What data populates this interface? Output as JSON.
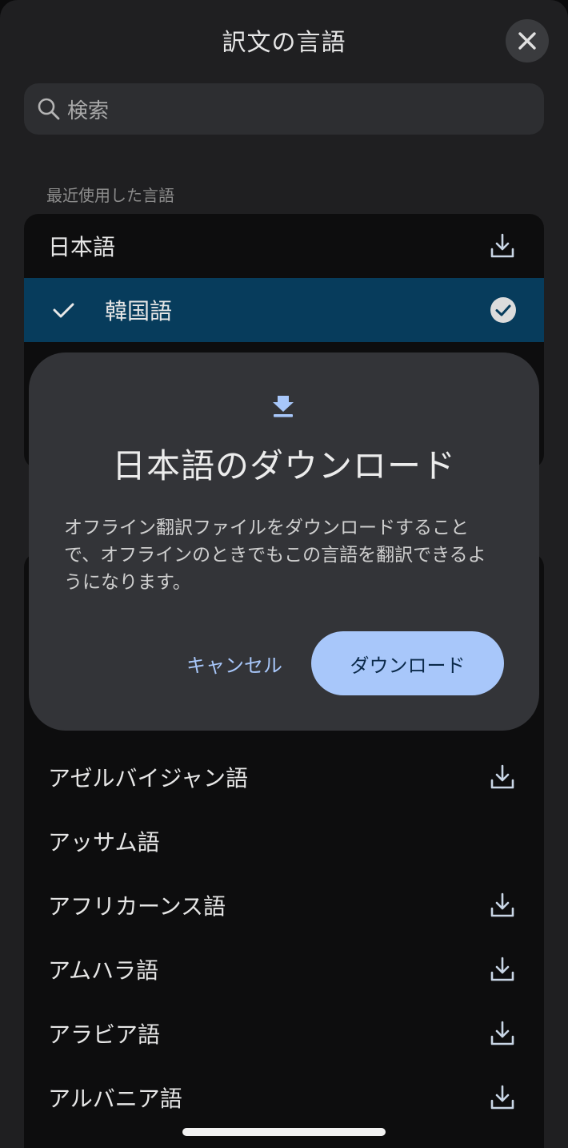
{
  "header": {
    "title": "訳文の言語",
    "close_icon": "close-icon"
  },
  "search": {
    "placeholder": "検索",
    "icon": "search-icon"
  },
  "recent": {
    "label": "最近使用した言語",
    "items": [
      {
        "label": "日本語",
        "icon": "download-icon",
        "selected": false
      },
      {
        "label": "韓国語",
        "icon": "check-circle-icon",
        "selected": true
      }
    ]
  },
  "all_languages": {
    "items": [
      {
        "label": "アゼルバイジャン語",
        "icon": "download-icon"
      },
      {
        "label": "アッサム語",
        "icon": ""
      },
      {
        "label": "アフリカーンス語",
        "icon": "download-icon"
      },
      {
        "label": "アムハラ語",
        "icon": "download-icon"
      },
      {
        "label": "アラビア語",
        "icon": "download-icon"
      },
      {
        "label": "アルバニア語",
        "icon": "download-icon"
      }
    ]
  },
  "dialog": {
    "icon": "download-icon",
    "title": "日本語のダウンロード",
    "body_lines": [
      "オフライン翻訳ファイルをダウンロードすること",
      "で、オフラインのときでもこの言語を翻訳できるよ",
      "うになります。"
    ],
    "cancel_label": "キャンセル",
    "download_label": "ダウンロード"
  },
  "colors": {
    "sheet_bg": "#1f1f21",
    "selected_row": "#073c5c",
    "dialog_bg": "#333438",
    "accent": "#a8c7fa"
  }
}
